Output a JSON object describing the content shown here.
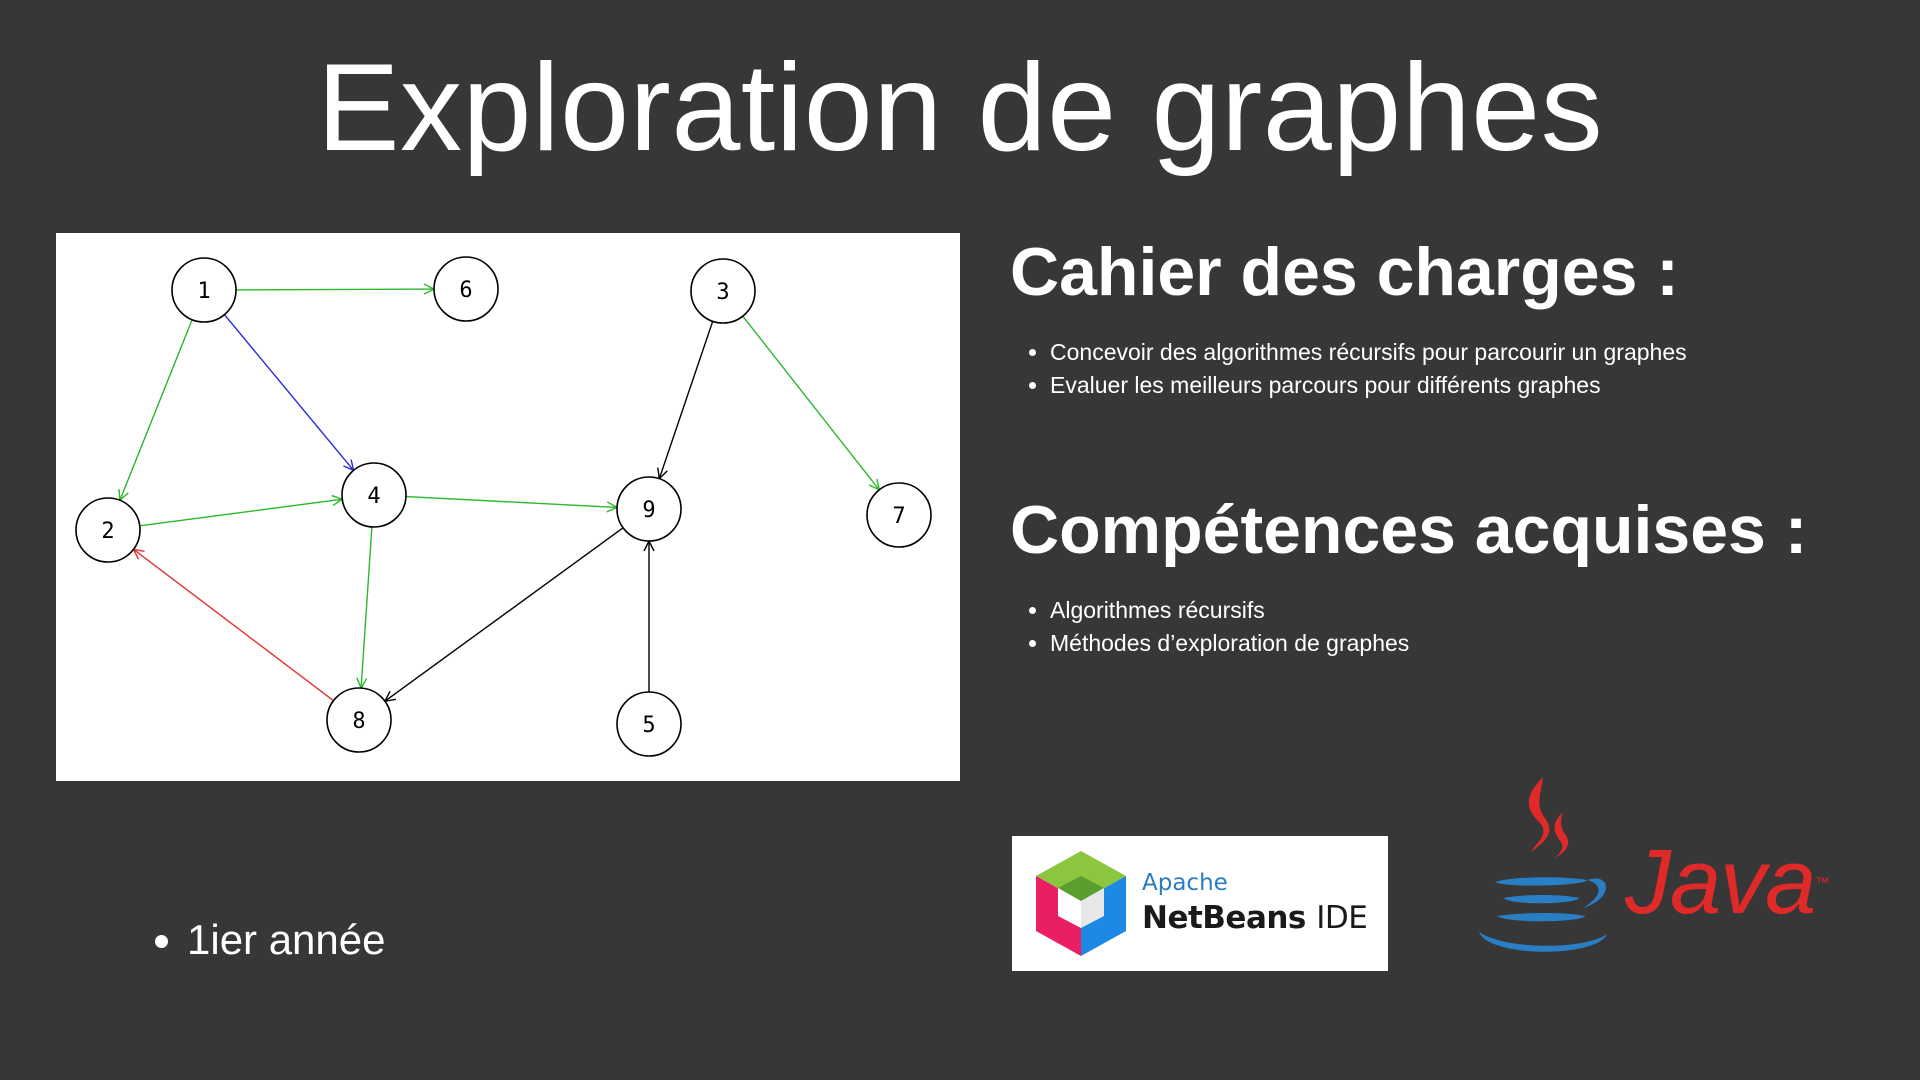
{
  "slide": {
    "title": "Exploration de graphes"
  },
  "sections": [
    {
      "title": "Cahier des charges :",
      "bullets": [
        "Concevoir des algorithmes récursifs pour parcourir un graphes",
        "Evaluer les meilleurs parcours pour différents graphes"
      ]
    },
    {
      "title": "Compétences acquises :",
      "bullets": [
        "Algorithmes récursifs",
        "Méthodes d’exploration de graphes"
      ]
    }
  ],
  "year_bullet": "1ier année",
  "graph": {
    "nodes": [
      "1",
      "2",
      "3",
      "4",
      "5",
      "6",
      "7",
      "8",
      "9"
    ],
    "edges": [
      {
        "from": "1",
        "to": "6",
        "color": "#2db82d"
      },
      {
        "from": "1",
        "to": "2",
        "color": "#2db82d"
      },
      {
        "from": "1",
        "to": "4",
        "color": "#2b2bd6"
      },
      {
        "from": "2",
        "to": "4",
        "color": "#2db82d"
      },
      {
        "from": "4",
        "to": "9",
        "color": "#2db82d"
      },
      {
        "from": "4",
        "to": "8",
        "color": "#2db82d"
      },
      {
        "from": "8",
        "to": "2",
        "color": "#e63232"
      },
      {
        "from": "9",
        "to": "8",
        "color": "#000000"
      },
      {
        "from": "5",
        "to": "9",
        "color": "#000000"
      },
      {
        "from": "3",
        "to": "9",
        "color": "#000000"
      },
      {
        "from": "3",
        "to": "7",
        "color": "#2db82d"
      }
    ]
  },
  "logos": {
    "netbeans": {
      "apache": "Apache",
      "name": "NetBeans",
      "ide": "IDE"
    },
    "java": {
      "text": "Java",
      "tm": "™"
    }
  },
  "colors": {
    "background": "#373737",
    "text": "#ffffff",
    "java_red": "#e02a2a",
    "java_blue": "#2a7fc4"
  }
}
